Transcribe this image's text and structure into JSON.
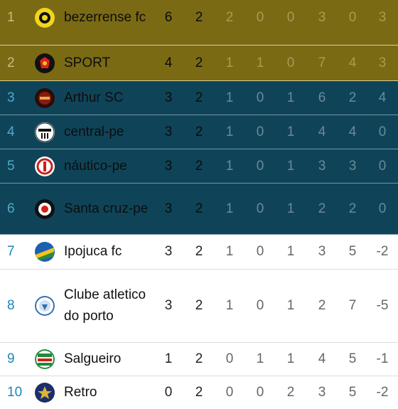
{
  "standings": [
    {
      "pos": "1",
      "name": "bezerrense fc",
      "pts": "6",
      "j": "2",
      "v": "2",
      "e": "0",
      "d": "0",
      "gp": "3",
      "gc": "0",
      "sg": "3",
      "style": "gold",
      "crest": "black-yellow"
    },
    {
      "pos": "2",
      "name": "SPORT",
      "pts": "4",
      "j": "2",
      "v": "1",
      "e": "1",
      "d": "0",
      "gp": "7",
      "gc": "4",
      "sg": "3",
      "style": "gold",
      "crest": "red-black"
    },
    {
      "pos": "3",
      "name": "Arthur SC",
      "pts": "3",
      "j": "2",
      "v": "1",
      "e": "0",
      "d": "1",
      "gp": "6",
      "gc": "2",
      "sg": "4",
      "style": "teal",
      "crest": "dark-red"
    },
    {
      "pos": "4",
      "name": "central-pe",
      "pts": "3",
      "j": "2",
      "v": "1",
      "e": "0",
      "d": "1",
      "gp": "4",
      "gc": "4",
      "sg": "0",
      "style": "teal",
      "crest": "black-white"
    },
    {
      "pos": "5",
      "name": "náutico-pe",
      "pts": "3",
      "j": "2",
      "v": "1",
      "e": "0",
      "d": "1",
      "gp": "3",
      "gc": "3",
      "sg": "0",
      "style": "teal",
      "crest": "red-white"
    },
    {
      "pos": "6",
      "name": "Santa cruz-pe",
      "pts": "3",
      "j": "2",
      "v": "1",
      "e": "0",
      "d": "1",
      "gp": "2",
      "gc": "2",
      "sg": "0",
      "style": "teal",
      "crest": "black-red"
    },
    {
      "pos": "7",
      "name": "Ipojuca fc",
      "pts": "3",
      "j": "2",
      "v": "1",
      "e": "0",
      "d": "1",
      "gp": "3",
      "gc": "5",
      "sg": "-2",
      "style": "white",
      "crest": "blue-yellow"
    },
    {
      "pos": "8",
      "name": "Clube atletico do porto",
      "pts": "3",
      "j": "2",
      "v": "1",
      "e": "0",
      "d": "1",
      "gp": "2",
      "gc": "7",
      "sg": "-5",
      "style": "white",
      "crest": "blue-white"
    },
    {
      "pos": "9",
      "name": "Salgueiro",
      "pts": "1",
      "j": "2",
      "v": "0",
      "e": "1",
      "d": "1",
      "gp": "4",
      "gc": "5",
      "sg": "-1",
      "style": "white",
      "crest": "green-red"
    },
    {
      "pos": "10",
      "name": "Retro",
      "pts": "0",
      "j": "2",
      "v": "0",
      "e": "0",
      "d": "2",
      "gp": "3",
      "gc": "5",
      "sg": "-2",
      "style": "white",
      "crest": "navy-gold"
    }
  ],
  "colors": {
    "gold": "#7a6a14",
    "teal": "#0f4458",
    "position_link": "#1b86b8"
  }
}
